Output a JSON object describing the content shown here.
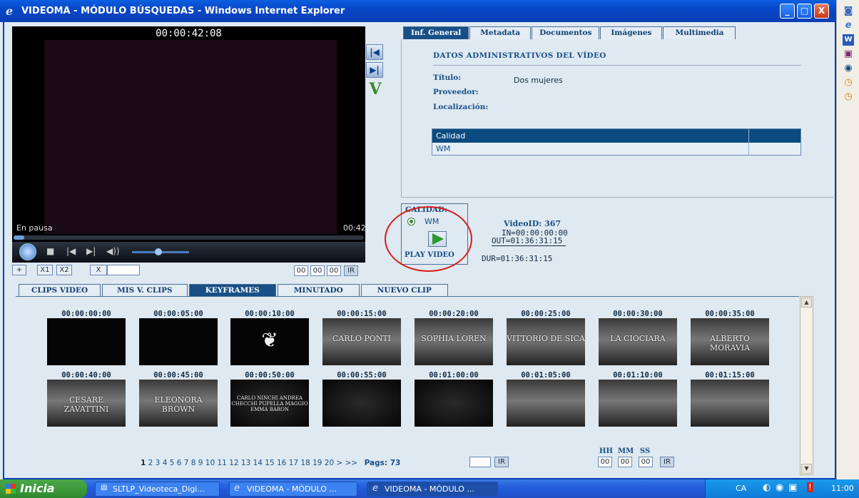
{
  "window": {
    "title": "VIDEOMA - MÓDULO BÚSQUEDAS - Windows Internet Explorer",
    "min": "_",
    "max": "□",
    "close": "X"
  },
  "player": {
    "timecode": "00:00:42:08",
    "status": "En pausa",
    "position": "00:42",
    "progress": 0.03
  },
  "controls": {
    "add": "+",
    "x1": "X1",
    "x2": "X2",
    "x": "X",
    "hh": "00",
    "mm": "00",
    "ss": "00",
    "go": "IR"
  },
  "info_tabs": [
    "Inf. General",
    "Metadata",
    "Documentos",
    "Imágenes",
    "Multimedia"
  ],
  "info": {
    "section_title": "DATOS ADMINISTRATIVOS DEL VÍDEO",
    "titulo_label": "Título:",
    "titulo_value": "Dos mujeres",
    "proveedor_label": "Proveedor:",
    "localizacion_label": "Localización:",
    "table_header": "Calidad",
    "table_value": "WM"
  },
  "calidad": {
    "title": "CALIDAD:",
    "option": "WM",
    "play_label": "PLAY VIDEO"
  },
  "video_meta": {
    "videoid": "VideoID: 367",
    "in": "IN=00:00:00:00",
    "out": "OUT=01:36:31:15",
    "dur": "DUR=01:36:31:15"
  },
  "bottom_tabs": [
    "CLIPS VIDEO",
    "MIS V. CLIPS",
    "KEYFRAMES",
    "MINUTADO",
    "NUEVO CLIP"
  ],
  "keyframes": [
    {
      "time": "00:00:00:00",
      "caption": "",
      "style": "black"
    },
    {
      "time": "00:00:05:00",
      "caption": "",
      "style": "black"
    },
    {
      "time": "00:00:10:00",
      "caption": "",
      "style": "emblem"
    },
    {
      "time": "00:00:15:00",
      "caption": "CARLO PONTI",
      "style": "scene"
    },
    {
      "time": "00:00:20:00",
      "caption": "SOPHIA LOREN",
      "style": "scene"
    },
    {
      "time": "00:00:25:00",
      "caption": "VITTORIO DE SICA",
      "style": "scene"
    },
    {
      "time": "00:00:30:00",
      "caption": "LA CIOCIARA",
      "style": "scene"
    },
    {
      "time": "00:00:35:00",
      "caption": "ALBERTO MORAVIA",
      "style": "scene"
    },
    {
      "time": "00:00:40:00",
      "caption": "CESARE ZAVATTINI",
      "style": "scene"
    },
    {
      "time": "00:00:45:00",
      "caption": "ELEONORA BROWN",
      "style": "scene"
    },
    {
      "time": "00:00:50:00",
      "caption": "CARLO NINCHI ANDREA CHECCHI PUPELLA MAGGIO EMMA BARON",
      "style": "text"
    },
    {
      "time": "00:00:55:00",
      "caption": "",
      "style": "text"
    },
    {
      "time": "00:01:00:00",
      "caption": "",
      "style": "text"
    },
    {
      "time": "00:01:05:00",
      "caption": "",
      "style": "scene"
    },
    {
      "time": "00:01:10:00",
      "caption": "",
      "style": "scene"
    },
    {
      "time": "00:01:15:00",
      "caption": "",
      "style": "scene"
    }
  ],
  "pagination": {
    "current": "1",
    "pages": "2 3 4 5 6 7 8 9 10 11 12 13 14 15 16 17 18 19 20",
    "next": "> >>",
    "total_label": "Pags: 73",
    "go": "IR"
  },
  "time_jump": {
    "hh_label": "HH",
    "mm_label": "MM",
    "ss_label": "SS",
    "hh": "00",
    "mm": "00",
    "ss": "00",
    "go": "IR"
  },
  "taskbar": {
    "start": "Inicia",
    "tasks": [
      "SLTLP_Videoteca_Digi...",
      "VIDEOMA - MÓDULO ...",
      "VIDEOMA - MÓDULO ..."
    ],
    "lang": "CA",
    "clock": "11:00"
  }
}
